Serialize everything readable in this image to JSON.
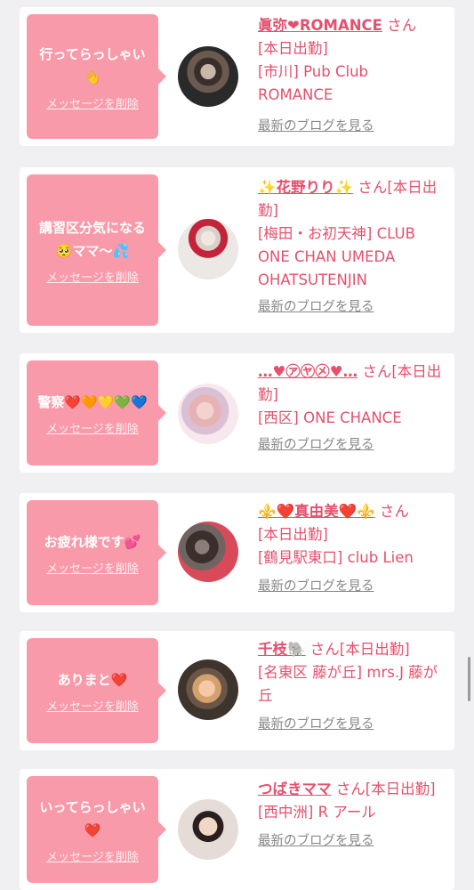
{
  "cards": [
    {
      "message": "行ってらっしゃい👋",
      "delete_label": "メッセージを削除",
      "name": "眞弥❤ROMANCE",
      "san": "さん",
      "status": "[本日出勤]",
      "area": "[市川]",
      "shop": "Pub Club ROMANCE",
      "blog": "最新のブログを見る"
    },
    {
      "message": "講習区分気になる🥺ママ〜💦",
      "delete_label": "メッセージを削除",
      "name": "✨花野りり✨",
      "san": "さん",
      "status": "[本日出勤]",
      "area": "[梅田・お初天神]",
      "shop": "CLUB ONE CHAN UMEDA OHATSUTENJIN",
      "blog": "最新のブログを見る"
    },
    {
      "message": "警察❤️🧡💛💚💙",
      "delete_label": "メッセージを削除",
      "name": "…♥㋐㋳㋱♥…",
      "san": "さん",
      "status": "[本日出勤]",
      "area": "[西区]",
      "shop": "ONE CHANCE",
      "blog": "最新のブログを見る"
    },
    {
      "message": "お疲れ様です💕",
      "delete_label": "メッセージを削除",
      "name": "⚜️❤️真由美❤️⚜️",
      "san": "さん",
      "status": "[本日出勤]",
      "area": "[鶴見駅東口]",
      "shop": "club Lien",
      "blog": "最新のブログを見る"
    },
    {
      "message": "ありまと❤️",
      "delete_label": "メッセージを削除",
      "name": "千枝🐘",
      "san": "さん",
      "status": "[本日出勤]",
      "area": "[名東区 藤が丘]",
      "shop": "mrs.J 藤が丘",
      "blog": "最新のブログを見る"
    },
    {
      "message": "いってらっしゃい❤️",
      "delete_label": "メッセージを削除",
      "name": "つばきママ",
      "san": "さん",
      "status": "[本日出勤]",
      "area": "[西中洲]",
      "shop": "R アール",
      "blog": "最新のブログを見る"
    }
  ]
}
